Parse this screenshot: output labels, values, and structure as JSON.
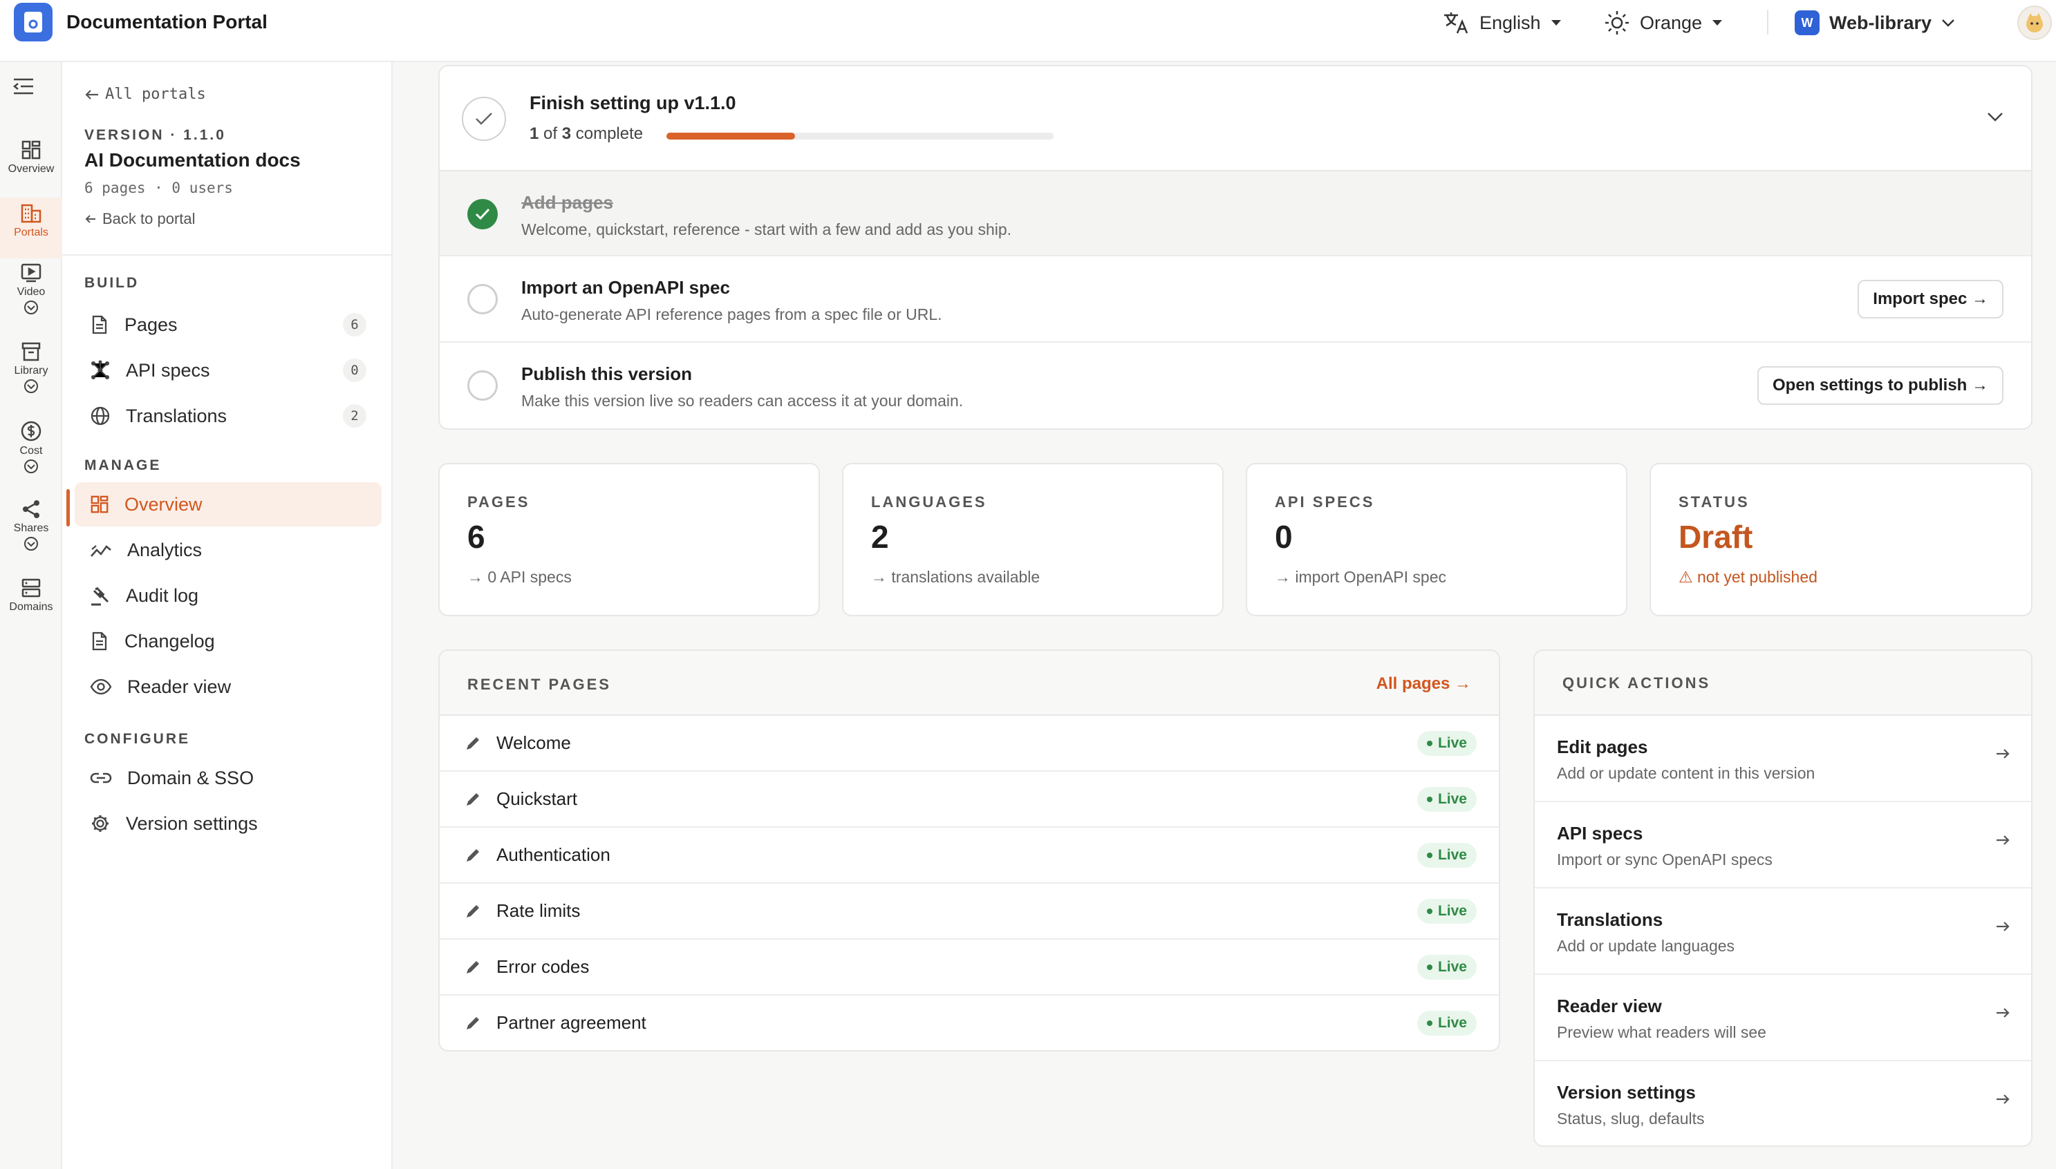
{
  "app": {
    "title": "Documentation Portal"
  },
  "topbar": {
    "language": "English",
    "theme": "Orange",
    "workspace_badge": "W",
    "workspace": "Web-library"
  },
  "rail": {
    "items": [
      {
        "label": "Overview"
      },
      {
        "label": "Portals"
      },
      {
        "label": "Video"
      },
      {
        "label": "Library"
      },
      {
        "label": "Cost"
      },
      {
        "label": "Shares"
      },
      {
        "label": "Domains"
      }
    ]
  },
  "sidebar": {
    "back_link": "All portals",
    "version_label": "VERSION · 1.1.0",
    "portal_name": "AI Documentation docs",
    "meta": "6 pages · 0 users",
    "back_to_portal": "Back to portal",
    "sections": {
      "build": "BUILD",
      "manage": "MANAGE",
      "configure": "CONFIGURE"
    },
    "build_items": [
      {
        "label": "Pages",
        "count": "6",
        "icon": "page-icon"
      },
      {
        "label": "API specs",
        "count": "0",
        "icon": "api-nodes-icon"
      },
      {
        "label": "Translations",
        "count": "2",
        "icon": "globe-icon"
      }
    ],
    "manage_items": [
      {
        "label": "Overview",
        "icon": "grid-icon"
      },
      {
        "label": "Analytics",
        "icon": "chart-line-icon"
      },
      {
        "label": "Audit log",
        "icon": "gavel-icon"
      },
      {
        "label": "Changelog",
        "icon": "document-icon"
      },
      {
        "label": "Reader view",
        "icon": "eye-icon"
      }
    ],
    "configure_items": [
      {
        "label": "Domain & SSO",
        "icon": "link-icon"
      },
      {
        "label": "Version settings",
        "icon": "gear-icon"
      }
    ]
  },
  "setup": {
    "title": "Finish setting up v1.1.0",
    "progress_prefix": "1",
    "progress_mid": " of ",
    "progress_total": "3",
    "progress_suffix": " complete",
    "progress_fraction": 0.333,
    "steps": [
      {
        "title": "Add pages",
        "desc": "Welcome, quickstart, reference - start with a few and add as you ship.",
        "done": true
      },
      {
        "title": "Import an OpenAPI spec",
        "desc": "Auto-generate API reference pages from a spec file or URL.",
        "button": "Import spec →"
      },
      {
        "title": "Publish this version",
        "desc": "Make this version live so readers can access it at your domain.",
        "button": "Open settings to publish →"
      }
    ]
  },
  "stats": [
    {
      "label": "PAGES",
      "value": "6",
      "sub": "→ 0 API specs"
    },
    {
      "label": "LANGUAGES",
      "value": "2",
      "sub": "→ translations available"
    },
    {
      "label": "API SPECS",
      "value": "0",
      "sub": "→ import OpenAPI spec"
    },
    {
      "label": "STATUS",
      "value": "Draft",
      "sub": "⚠ not yet published"
    }
  ],
  "recent_pages": {
    "title": "RECENT PAGES",
    "all_link": "All pages →",
    "status_label": "Live",
    "items": [
      "Welcome",
      "Quickstart",
      "Authentication",
      "Rate limits",
      "Error codes",
      "Partner agreement"
    ]
  },
  "quick_actions": {
    "title": "QUICK ACTIONS",
    "items": [
      {
        "title": "Edit pages",
        "sub": "Add or update content in this version"
      },
      {
        "title": "API specs",
        "sub": "Import or sync OpenAPI specs"
      },
      {
        "title": "Translations",
        "sub": "Add or update languages"
      },
      {
        "title": "Reader view",
        "sub": "Preview what readers will see"
      },
      {
        "title": "Version settings",
        "sub": "Status, slug, defaults"
      }
    ]
  },
  "colors": {
    "accent": "#d9632a",
    "live_green": "#2f8a45",
    "brand_blue": "#3b6fe0"
  }
}
